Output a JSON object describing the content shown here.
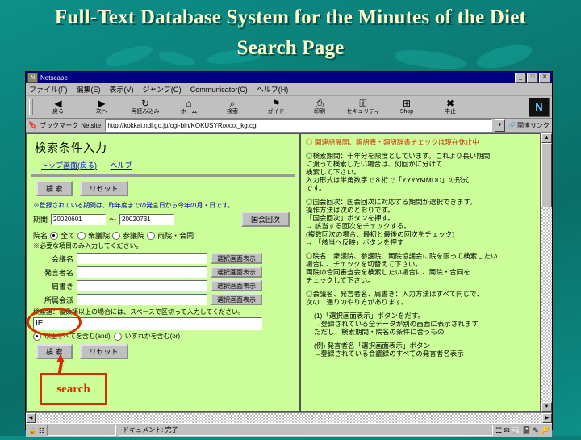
{
  "slide": {
    "title_line1": "Full-Text Database System for the Minutes of the Diet",
    "title_line2": "Search Page",
    "title_color": "#ffffcc",
    "background_color": "#0b7f78"
  },
  "browser": {
    "window_title": "Netscape",
    "app_icon": "netscape-icon",
    "window_buttons": {
      "minimize": "_",
      "restore": "□",
      "close": "✕"
    },
    "menus": [
      "ファイル(F)",
      "編集(E)",
      "表示(V)",
      "ジャンプ(G)",
      "Communicator(C)",
      "ヘルプ(H)"
    ],
    "toolbar": [
      {
        "label": "戻る",
        "icon": "back-arrow-icon",
        "glyph": "◀"
      },
      {
        "label": "次へ",
        "icon": "forward-arrow-icon",
        "glyph": "▶"
      },
      {
        "label": "再読み込み",
        "icon": "reload-icon",
        "glyph": "↻"
      },
      {
        "label": "ホーム",
        "icon": "home-icon",
        "glyph": "⌂"
      },
      {
        "label": "検索",
        "icon": "search-icon",
        "glyph": "⌕"
      },
      {
        "label": "ガイド",
        "icon": "guide-icon",
        "glyph": "⚑"
      },
      {
        "label": "印刷",
        "icon": "print-icon",
        "glyph": "⎙"
      },
      {
        "label": "セキュリティ",
        "icon": "lock-icon",
        "glyph": "⚿"
      },
      {
        "label": "Shop",
        "icon": "shop-icon",
        "glyph": "⊞"
      },
      {
        "label": "中止",
        "icon": "stop-icon",
        "glyph": "✖"
      }
    ],
    "brand_logo": "netscape-n-logo",
    "location": {
      "bookmark_label": "ブックマーク",
      "bookmark_icon": "bookmark-icon",
      "netsite_label": "Netsite:",
      "url": "http://kokkai.ndl.go.jp/cgi-bin/KOKUSYR/xxxx_kg.cgi",
      "dropdown_icon": "chevron-down-icon",
      "related_label": "関連リンク",
      "related_icon": "related-links-icon"
    },
    "statusbar": {
      "security_icon": "padlock-icon",
      "connection_icon": "connection-icon",
      "message": "ドキュメント: 完了",
      "component_icons": [
        "navigator-icon",
        "mailbox-icon",
        "newsgroup-icon",
        "addressbook-icon",
        "composer-icon",
        "security-icon"
      ]
    }
  },
  "left_pane": {
    "heading": "検索条件入力",
    "links": [
      "トップ画面(戻る)",
      "ヘルプ"
    ],
    "top_buttons": [
      "検 索",
      "リセット"
    ],
    "date_note": "※登録されている期間は、昨年度までの発言日から今年の月・日です。",
    "date_label": "期間",
    "date_from": "20020601",
    "date_to": "20020731",
    "date_sep": "～",
    "kaiji_button": "国会回次",
    "house_label": "院名",
    "house_options": [
      "全て",
      "衆議院",
      "参議院",
      "両院・合同"
    ],
    "house_selected": "全て",
    "required_note": "※必要な項目のみ入力してください。",
    "fields": [
      {
        "label": "会議名",
        "value": "",
        "button": "選択画面表示"
      },
      {
        "label": "発言者名",
        "value": "",
        "button": "選択画面表示"
      },
      {
        "label": "肩書き",
        "value": "",
        "button": "選択画面表示"
      },
      {
        "label": "所属会派",
        "value": "",
        "button": "選択画面表示"
      }
    ],
    "keyword_label": "検索語：複数語以上の場合には、スペースで区切って入力してください。",
    "keyword_value": "IE",
    "keyword_options": [
      "以上すべてを含む(and)",
      "いずれかを含む(or)"
    ],
    "keyword_selected": "以上すべてを含む(and)",
    "bottom_buttons": [
      "検 索",
      "リセット"
    ]
  },
  "right_pane": {
    "paragraphs": [
      {
        "style": "red",
        "text": "◎ 関連語展開、類語表・類語辞書チェックは現在休止中"
      },
      {
        "style": "normal",
        "text": "◎検索期間：十年分を限度としています。これより長い期間\nに渡って検索したい場合は、何回かに分けて\n検索して下さい。\n入力形式は半角数字で８桁で「YYYYMMDD」の形式\nです。"
      },
      {
        "style": "normal",
        "text": "◎国会回次：国会回次に対応する期間が選択できます。\n操作方法は次のとおりです。\n「国会回次」ボタンを押す。\n→ 該当する回次をチェックする。\n(複数回次の場合、最初と最後の回次をチェック)\n→ 「該当へ反映」ボタンを押す"
      },
      {
        "style": "normal",
        "text": "◎院名：衆議院、参議院、両院協議会に院を限って検索したい\n場合に、チェックを切替えて下さい。\n両院の合同審査会を検索したい場合に、両院・合同を\nチェックして下さい。"
      },
      {
        "style": "normal",
        "text": "◎会議名、発言者名、肩書き：入力方法はすべて同じで、\n次の二通りのやり方があります。"
      },
      {
        "style": "normal",
        "text": "(1)「選択画面表示」ボタンをだす。\n→登録されている全データが別の画面に表示されます\nただし、検索期間・院名の条件に合うもの"
      },
      {
        "style": "normal",
        "text": "(例) 発言者名「選択画面表示」ボタン\n→登録されている会議録のすべての発言者名表示"
      }
    ],
    "scroll_up_icon": "scroll-up-arrow",
    "scroll_down_icon": "scroll-down-arrow"
  },
  "annotations": {
    "callout_label": "search",
    "callout_color": "#cc3300",
    "ellipse_target": "keyword-search-label",
    "arrow_target": "search-submit-button"
  }
}
